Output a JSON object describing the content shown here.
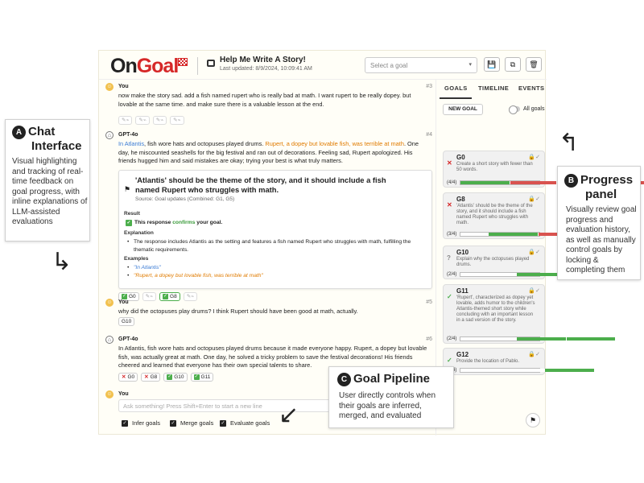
{
  "header": {
    "logo_on": "On",
    "logo_goal": "Goal",
    "title": "Help Me Write A Story!",
    "updated": "Last updated: 8/9/2024, 10:09:41 AM",
    "select_placeholder": "Select a goal",
    "select_caret": "▾",
    "btn_save": "💾",
    "btn_copy": "⧉",
    "btn_delete": "🗑"
  },
  "chat": {
    "m1": {
      "who": "You",
      "num": "#3",
      "text": "now make the story sad. add a fish named rupert who is really bad at math. I want rupert to be really dopey. but lovable at the same time. and make sure there is a valuable lesson at the end."
    },
    "m2": {
      "who": "GPT-4o",
      "num": "#4",
      "t1": "In Atlantis",
      "t2": ", fish wore hats and octopuses played drums. ",
      "t3": "Rupert, a dopey but lovable fish, was terrible at math",
      "t4": ". One day, he miscounted seashells for the big festival and ran out of decorations. Feeling sad, Rupert apologized. His friends hugged him and said mistakes are okay; trying your best is what truly matters."
    },
    "eval": {
      "title": "'Atlantis' should be the theme of the story, and it should include a fish named Rupert who struggles with math.",
      "source": "Source: Goal updates (Combined: G1, G5)",
      "result_h": "Result",
      "r1": "This response ",
      "r2": "confirms",
      "r3": " your goal.",
      "expl_h": "Explanation",
      "expl": "The response includes Atlantis as the setting and features a fish named Rupert who struggles with math, fulfilling the thematic requirements.",
      "ex_h": "Examples",
      "ex1": "\"In Atlantis\"",
      "ex2": "\"Rupert, a dopey but lovable fish, was terrible at math\"",
      "check": "✓",
      "bullet": "•",
      "chip_g0": "G0",
      "chip_g8": "G8"
    },
    "m3": {
      "who": "You",
      "num": "#5",
      "text": "why did the octopuses play drums? I think Rupert should have been good at math, actually.",
      "chip": "G10"
    },
    "m4": {
      "who": "GPT-4o",
      "num": "#6",
      "text": "In Atlantis, fish wore hats and octopuses played drums because it made everyone happy. Rupert, a dopey but lovable fish, was actually great at math. One day, he solved a tricky problem to save the festival decorations! His friends cheered and learned that everyone has their own special talents to share.",
      "chips": [
        "G0",
        "G8",
        "G10",
        "G11"
      ]
    },
    "m5": {
      "who": "You"
    },
    "input_placeholder": "Ask something! Press Shift+Enter to start a new line",
    "options": [
      "Infer goals",
      "Merge goals",
      "Evaluate goals"
    ]
  },
  "goals_panel": {
    "tabs": [
      "GOALS",
      "TIMELINE",
      "EVENTS"
    ],
    "new_goal": "NEW GOAL",
    "all_goals": "All goals",
    "cards": [
      {
        "id": "G0",
        "desc": "Create a short story with fewer than 50 words.",
        "count": "(4/4)",
        "status": "✕",
        "segments": [
          "#4cae4c",
          "#d9534f",
          "#d9534f",
          "#d9534f"
        ]
      },
      {
        "id": "G8",
        "desc": "'Atlantis' should be the theme of the story, and it should include a fish named Rupert who struggles with math.",
        "count": "(3/4)",
        "status": "✕",
        "segments": [
          "#ffffff",
          "#4cae4c",
          "#d9534f",
          "#d9534f"
        ]
      },
      {
        "id": "G10",
        "desc": "Explain why the octopuses played drums.",
        "count": "(2/4)",
        "status": "?",
        "segments": [
          "#ffffff",
          "#ffffff",
          "#4cae4c",
          "#e8b84a"
        ]
      },
      {
        "id": "G11",
        "desc": "'Rupert', characterized as dopey yet lovable, adds humor to the children's Atlantis-themed short story while concluding with an important lesson in a sad version of the story.",
        "count": "(2/4)",
        "status": "✓",
        "segments": [
          "#ffffff",
          "#ffffff",
          "#4cae4c",
          "#4cae4c"
        ]
      },
      {
        "id": "G12",
        "desc": "Provide the location of Pablo.",
        "count": "(1/4)",
        "status": "✓",
        "segments": [
          "#ffffff",
          "#ffffff",
          "#ffffff",
          "#4cae4c"
        ]
      }
    ]
  },
  "annotations": {
    "a": {
      "badge": "A",
      "title1": "Chat",
      "title2": "Interface",
      "text": "Visual highlighting and tracking of real-time feedback on goal progress, with inline explanations of LLM-assisted evaluations"
    },
    "b": {
      "badge": "B",
      "title1": "Progress",
      "title2": "panel",
      "text": "Visually review goal progress and evaluation history, as well as manually control goals by locking & completing them"
    },
    "c": {
      "badge": "C",
      "title": "Goal Pipeline",
      "text": "User directly controls when their goals are inferred, merged, and evaluated"
    }
  }
}
